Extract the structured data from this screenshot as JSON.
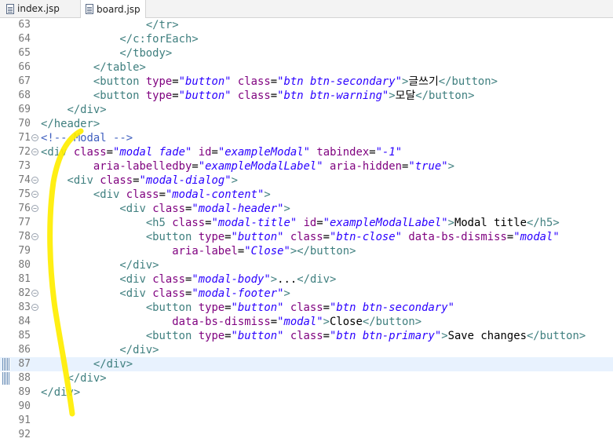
{
  "tabs": [
    {
      "label": "index.jsp",
      "active": false
    },
    {
      "label": "board.jsp",
      "active": true
    }
  ],
  "current_line": 87,
  "lines": [
    {
      "num": "63",
      "fold": "",
      "indent": "                ",
      "tokens": [
        {
          "t": "t",
          "s": "</tr>"
        }
      ]
    },
    {
      "num": "64",
      "fold": "",
      "indent": "            ",
      "tokens": [
        {
          "t": "t",
          "s": "</c:forEach>"
        }
      ]
    },
    {
      "num": "65",
      "fold": "",
      "indent": "            ",
      "tokens": [
        {
          "t": "t",
          "s": "</tbody>"
        }
      ]
    },
    {
      "num": "66",
      "fold": "",
      "indent": "        ",
      "tokens": [
        {
          "t": "t",
          "s": "</table>"
        }
      ]
    },
    {
      "num": "67",
      "fold": "",
      "indent": "        ",
      "tokens": [
        {
          "t": "t",
          "s": "<button "
        },
        {
          "t": "a",
          "s": "type"
        },
        {
          "t": "p",
          "s": "="
        },
        {
          "t": "v",
          "s": "\"button\""
        },
        {
          "t": "p",
          "s": " "
        },
        {
          "t": "a",
          "s": "class"
        },
        {
          "t": "p",
          "s": "="
        },
        {
          "t": "v",
          "s": "\"btn btn-secondary\""
        },
        {
          "t": "t",
          "s": ">"
        },
        {
          "t": "p",
          "s": "글쓰기"
        },
        {
          "t": "t",
          "s": "</button>"
        }
      ]
    },
    {
      "num": "68",
      "fold": "",
      "indent": "        ",
      "tokens": [
        {
          "t": "t",
          "s": "<button "
        },
        {
          "t": "a",
          "s": "type"
        },
        {
          "t": "p",
          "s": "="
        },
        {
          "t": "v",
          "s": "\"button\""
        },
        {
          "t": "p",
          "s": " "
        },
        {
          "t": "a",
          "s": "class"
        },
        {
          "t": "p",
          "s": "="
        },
        {
          "t": "v",
          "s": "\"btn btn-warning\""
        },
        {
          "t": "t",
          "s": ">"
        },
        {
          "t": "p",
          "s": "모달"
        },
        {
          "t": "t",
          "s": "</button>"
        }
      ]
    },
    {
      "num": "69",
      "fold": "",
      "indent": "    ",
      "tokens": [
        {
          "t": "t",
          "s": "</div>"
        }
      ]
    },
    {
      "num": "70",
      "fold": "",
      "indent": "",
      "tokens": [
        {
          "t": "t",
          "s": "</header>"
        }
      ]
    },
    {
      "num": "71",
      "fold": "−",
      "indent": "",
      "tokens": [
        {
          "t": "c",
          "s": "<!-- Modal -->"
        }
      ]
    },
    {
      "num": "72",
      "fold": "−",
      "indent": "",
      "tokens": [
        {
          "t": "t",
          "s": "<div "
        },
        {
          "t": "a",
          "s": "class"
        },
        {
          "t": "p",
          "s": "="
        },
        {
          "t": "v",
          "s": "\"modal fade\""
        },
        {
          "t": "p",
          "s": " "
        },
        {
          "t": "a",
          "s": "id"
        },
        {
          "t": "p",
          "s": "="
        },
        {
          "t": "v",
          "s": "\"exampleModal\""
        },
        {
          "t": "p",
          "s": " "
        },
        {
          "t": "a",
          "s": "tabindex"
        },
        {
          "t": "p",
          "s": "="
        },
        {
          "t": "v",
          "s": "\"-1\""
        }
      ]
    },
    {
      "num": "73",
      "fold": "",
      "indent": "        ",
      "tokens": [
        {
          "t": "a",
          "s": "aria-labelledby"
        },
        {
          "t": "p",
          "s": "="
        },
        {
          "t": "v",
          "s": "\"exampleModalLabel\""
        },
        {
          "t": "p",
          "s": " "
        },
        {
          "t": "a",
          "s": "aria-hidden"
        },
        {
          "t": "p",
          "s": "="
        },
        {
          "t": "v",
          "s": "\"true\""
        },
        {
          "t": "t",
          "s": ">"
        }
      ]
    },
    {
      "num": "74",
      "fold": "−",
      "indent": "    ",
      "tokens": [
        {
          "t": "t",
          "s": "<div "
        },
        {
          "t": "a",
          "s": "class"
        },
        {
          "t": "p",
          "s": "="
        },
        {
          "t": "v",
          "s": "\"modal-dialog\""
        },
        {
          "t": "t",
          "s": ">"
        }
      ]
    },
    {
      "num": "75",
      "fold": "−",
      "indent": "        ",
      "tokens": [
        {
          "t": "t",
          "s": "<div "
        },
        {
          "t": "a",
          "s": "class"
        },
        {
          "t": "p",
          "s": "="
        },
        {
          "t": "v",
          "s": "\"modal-content\""
        },
        {
          "t": "t",
          "s": ">"
        }
      ]
    },
    {
      "num": "76",
      "fold": "−",
      "indent": "            ",
      "tokens": [
        {
          "t": "t",
          "s": "<div "
        },
        {
          "t": "a",
          "s": "class"
        },
        {
          "t": "p",
          "s": "="
        },
        {
          "t": "v",
          "s": "\"modal-header\""
        },
        {
          "t": "t",
          "s": ">"
        }
      ]
    },
    {
      "num": "77",
      "fold": "",
      "indent": "                ",
      "tokens": [
        {
          "t": "t",
          "s": "<h5 "
        },
        {
          "t": "a",
          "s": "class"
        },
        {
          "t": "p",
          "s": "="
        },
        {
          "t": "v",
          "s": "\"modal-title\""
        },
        {
          "t": "p",
          "s": " "
        },
        {
          "t": "a",
          "s": "id"
        },
        {
          "t": "p",
          "s": "="
        },
        {
          "t": "v",
          "s": "\"exampleModalLabel\""
        },
        {
          "t": "t",
          "s": ">"
        },
        {
          "t": "p",
          "s": "Modal title"
        },
        {
          "t": "t",
          "s": "</h5>"
        }
      ]
    },
    {
      "num": "78",
      "fold": "−",
      "indent": "                ",
      "tokens": [
        {
          "t": "t",
          "s": "<button "
        },
        {
          "t": "a",
          "s": "type"
        },
        {
          "t": "p",
          "s": "="
        },
        {
          "t": "v",
          "s": "\"button\""
        },
        {
          "t": "p",
          "s": " "
        },
        {
          "t": "a",
          "s": "class"
        },
        {
          "t": "p",
          "s": "="
        },
        {
          "t": "v",
          "s": "\"btn-close\""
        },
        {
          "t": "p",
          "s": " "
        },
        {
          "t": "a",
          "s": "data-bs-dismiss"
        },
        {
          "t": "p",
          "s": "="
        },
        {
          "t": "v",
          "s": "\"modal\""
        }
      ]
    },
    {
      "num": "79",
      "fold": "",
      "indent": "                    ",
      "tokens": [
        {
          "t": "a",
          "s": "aria-label"
        },
        {
          "t": "p",
          "s": "="
        },
        {
          "t": "v",
          "s": "\"Close\""
        },
        {
          "t": "t",
          "s": "></button>"
        }
      ]
    },
    {
      "num": "80",
      "fold": "",
      "indent": "            ",
      "tokens": [
        {
          "t": "t",
          "s": "</div>"
        }
      ]
    },
    {
      "num": "81",
      "fold": "",
      "indent": "            ",
      "tokens": [
        {
          "t": "t",
          "s": "<div "
        },
        {
          "t": "a",
          "s": "class"
        },
        {
          "t": "p",
          "s": "="
        },
        {
          "t": "v",
          "s": "\"modal-body\""
        },
        {
          "t": "t",
          "s": ">"
        },
        {
          "t": "p",
          "s": "..."
        },
        {
          "t": "t",
          "s": "</div>"
        }
      ]
    },
    {
      "num": "82",
      "fold": "−",
      "indent": "            ",
      "tokens": [
        {
          "t": "t",
          "s": "<div "
        },
        {
          "t": "a",
          "s": "class"
        },
        {
          "t": "p",
          "s": "="
        },
        {
          "t": "v",
          "s": "\"modal-footer\""
        },
        {
          "t": "t",
          "s": ">"
        }
      ]
    },
    {
      "num": "83",
      "fold": "−",
      "indent": "                ",
      "tokens": [
        {
          "t": "t",
          "s": "<button "
        },
        {
          "t": "a",
          "s": "type"
        },
        {
          "t": "p",
          "s": "="
        },
        {
          "t": "v",
          "s": "\"button\""
        },
        {
          "t": "p",
          "s": " "
        },
        {
          "t": "a",
          "s": "class"
        },
        {
          "t": "p",
          "s": "="
        },
        {
          "t": "v",
          "s": "\"btn btn-secondary\""
        }
      ]
    },
    {
      "num": "84",
      "fold": "",
      "indent": "                    ",
      "tokens": [
        {
          "t": "a",
          "s": "data-bs-dismiss"
        },
        {
          "t": "p",
          "s": "="
        },
        {
          "t": "v",
          "s": "\"modal\""
        },
        {
          "t": "t",
          "s": ">"
        },
        {
          "t": "p",
          "s": "Close"
        },
        {
          "t": "t",
          "s": "</button>"
        }
      ]
    },
    {
      "num": "85",
      "fold": "",
      "indent": "                ",
      "tokens": [
        {
          "t": "t",
          "s": "<button "
        },
        {
          "t": "a",
          "s": "type"
        },
        {
          "t": "p",
          "s": "="
        },
        {
          "t": "v",
          "s": "\"button\""
        },
        {
          "t": "p",
          "s": " "
        },
        {
          "t": "a",
          "s": "class"
        },
        {
          "t": "p",
          "s": "="
        },
        {
          "t": "v",
          "s": "\"btn btn-primary\""
        },
        {
          "t": "t",
          "s": ">"
        },
        {
          "t": "p",
          "s": "Save changes"
        },
        {
          "t": "t",
          "s": "</button>"
        }
      ]
    },
    {
      "num": "86",
      "fold": "",
      "indent": "            ",
      "tokens": [
        {
          "t": "t",
          "s": "</div>"
        }
      ]
    },
    {
      "num": "87",
      "fold": "",
      "indent": "        ",
      "tokens": [
        {
          "t": "t",
          "s": "</div>"
        }
      ]
    },
    {
      "num": "88",
      "fold": "",
      "indent": "    ",
      "tokens": [
        {
          "t": "t",
          "s": "</div>"
        }
      ]
    },
    {
      "num": "89",
      "fold": "",
      "indent": "",
      "tokens": [
        {
          "t": "t",
          "s": "</div>"
        }
      ]
    },
    {
      "num": "90",
      "fold": "",
      "indent": "",
      "tokens": []
    },
    {
      "num": "91",
      "fold": "",
      "indent": "",
      "tokens": []
    },
    {
      "num": "92",
      "fold": "",
      "indent": "",
      "tokens": []
    }
  ],
  "change_marker_lines": [
    87,
    88
  ],
  "colors": {
    "tag": "#3f7f7f",
    "attribute": "#7f007f",
    "value": "#2a00ff",
    "comment": "#3f5fbf",
    "current_line_bg": "#e8f2fe",
    "annotation_stroke": "#ffee00"
  }
}
